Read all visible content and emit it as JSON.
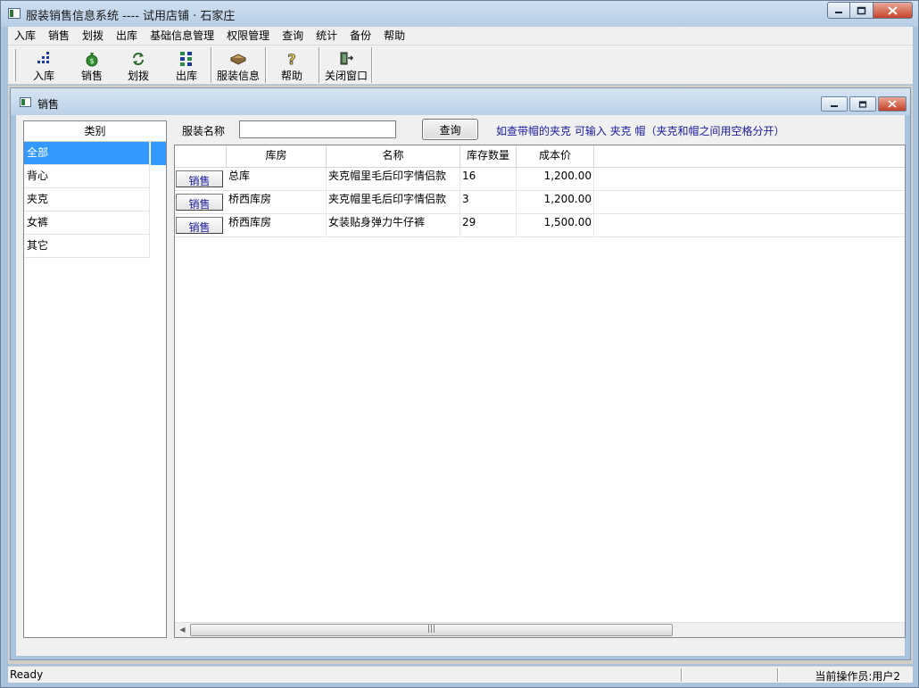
{
  "window": {
    "title": "服装销售信息系统 ---- 试用店铺 · 石家庄"
  },
  "menu": [
    "入库",
    "销售",
    "划拨",
    "出库",
    "基础信息管理",
    "权限管理",
    "查询",
    "统计",
    "备份",
    "帮助"
  ],
  "toolbar": {
    "stock_in": "入库",
    "sales": "销售",
    "transfer": "划拨",
    "stock_out": "出库",
    "clothing_info": "服装信息",
    "help": "帮助",
    "close_window": "关闭窗口"
  },
  "child": {
    "title": "销售"
  },
  "category": {
    "header": "类别",
    "items": [
      "全部",
      "背心",
      "夹克",
      "女裤",
      "其它"
    ],
    "selected": "全部"
  },
  "search": {
    "label": "服装名称",
    "value": "",
    "button": "查询",
    "hint": "如查带帽的夹克 可输入 夹克 帽（夹克和帽之间用空格分开）"
  },
  "grid": {
    "columns": [
      "",
      "库房",
      "名称",
      "库存数量",
      "成本价"
    ],
    "action_label": "销售",
    "rows": [
      {
        "warehouse": "总库",
        "name": "夹克帽里毛后印字情侣款",
        "qty": "16",
        "cost": "1,200.00"
      },
      {
        "warehouse": "桥西库房",
        "name": "夹克帽里毛后印字情侣款",
        "qty": "3",
        "cost": "1,200.00"
      },
      {
        "warehouse": "桥西库房",
        "name": "女装贴身弹力牛仔裤",
        "qty": "29",
        "cost": "1,500.00"
      }
    ]
  },
  "status": {
    "left": "Ready",
    "right": "当前操作员:用户2"
  },
  "colors": {
    "selection": "#3399ff",
    "hint_text": "#1a1aa0",
    "frame": "#a9c3de"
  }
}
